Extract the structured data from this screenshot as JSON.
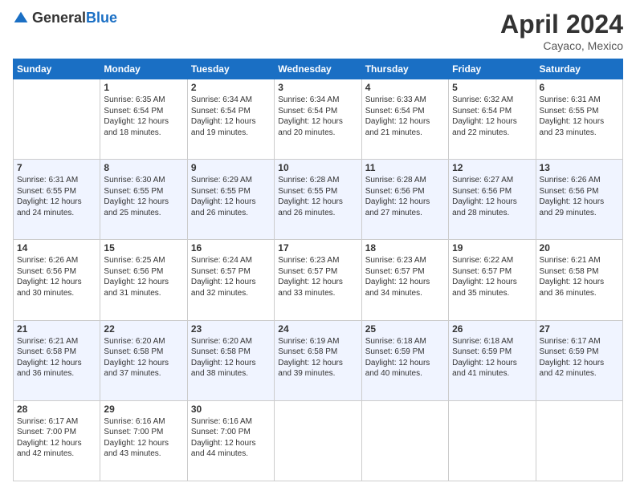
{
  "header": {
    "logo_general": "General",
    "logo_blue": "Blue",
    "title": "April 2024",
    "location": "Cayaco, Mexico"
  },
  "columns": [
    "Sunday",
    "Monday",
    "Tuesday",
    "Wednesday",
    "Thursday",
    "Friday",
    "Saturday"
  ],
  "weeks": [
    [
      {
        "day": "",
        "sunrise": "",
        "sunset": "",
        "daylight": ""
      },
      {
        "day": "1",
        "sunrise": "Sunrise: 6:35 AM",
        "sunset": "Sunset: 6:54 PM",
        "daylight": "Daylight: 12 hours and 18 minutes."
      },
      {
        "day": "2",
        "sunrise": "Sunrise: 6:34 AM",
        "sunset": "Sunset: 6:54 PM",
        "daylight": "Daylight: 12 hours and 19 minutes."
      },
      {
        "day": "3",
        "sunrise": "Sunrise: 6:34 AM",
        "sunset": "Sunset: 6:54 PM",
        "daylight": "Daylight: 12 hours and 20 minutes."
      },
      {
        "day": "4",
        "sunrise": "Sunrise: 6:33 AM",
        "sunset": "Sunset: 6:54 PM",
        "daylight": "Daylight: 12 hours and 21 minutes."
      },
      {
        "day": "5",
        "sunrise": "Sunrise: 6:32 AM",
        "sunset": "Sunset: 6:54 PM",
        "daylight": "Daylight: 12 hours and 22 minutes."
      },
      {
        "day": "6",
        "sunrise": "Sunrise: 6:31 AM",
        "sunset": "Sunset: 6:55 PM",
        "daylight": "Daylight: 12 hours and 23 minutes."
      }
    ],
    [
      {
        "day": "7",
        "sunrise": "Sunrise: 6:31 AM",
        "sunset": "Sunset: 6:55 PM",
        "daylight": "Daylight: 12 hours and 24 minutes."
      },
      {
        "day": "8",
        "sunrise": "Sunrise: 6:30 AM",
        "sunset": "Sunset: 6:55 PM",
        "daylight": "Daylight: 12 hours and 25 minutes."
      },
      {
        "day": "9",
        "sunrise": "Sunrise: 6:29 AM",
        "sunset": "Sunset: 6:55 PM",
        "daylight": "Daylight: 12 hours and 26 minutes."
      },
      {
        "day": "10",
        "sunrise": "Sunrise: 6:28 AM",
        "sunset": "Sunset: 6:55 PM",
        "daylight": "Daylight: 12 hours and 26 minutes."
      },
      {
        "day": "11",
        "sunrise": "Sunrise: 6:28 AM",
        "sunset": "Sunset: 6:56 PM",
        "daylight": "Daylight: 12 hours and 27 minutes."
      },
      {
        "day": "12",
        "sunrise": "Sunrise: 6:27 AM",
        "sunset": "Sunset: 6:56 PM",
        "daylight": "Daylight: 12 hours and 28 minutes."
      },
      {
        "day": "13",
        "sunrise": "Sunrise: 6:26 AM",
        "sunset": "Sunset: 6:56 PM",
        "daylight": "Daylight: 12 hours and 29 minutes."
      }
    ],
    [
      {
        "day": "14",
        "sunrise": "Sunrise: 6:26 AM",
        "sunset": "Sunset: 6:56 PM",
        "daylight": "Daylight: 12 hours and 30 minutes."
      },
      {
        "day": "15",
        "sunrise": "Sunrise: 6:25 AM",
        "sunset": "Sunset: 6:56 PM",
        "daylight": "Daylight: 12 hours and 31 minutes."
      },
      {
        "day": "16",
        "sunrise": "Sunrise: 6:24 AM",
        "sunset": "Sunset: 6:57 PM",
        "daylight": "Daylight: 12 hours and 32 minutes."
      },
      {
        "day": "17",
        "sunrise": "Sunrise: 6:23 AM",
        "sunset": "Sunset: 6:57 PM",
        "daylight": "Daylight: 12 hours and 33 minutes."
      },
      {
        "day": "18",
        "sunrise": "Sunrise: 6:23 AM",
        "sunset": "Sunset: 6:57 PM",
        "daylight": "Daylight: 12 hours and 34 minutes."
      },
      {
        "day": "19",
        "sunrise": "Sunrise: 6:22 AM",
        "sunset": "Sunset: 6:57 PM",
        "daylight": "Daylight: 12 hours and 35 minutes."
      },
      {
        "day": "20",
        "sunrise": "Sunrise: 6:21 AM",
        "sunset": "Sunset: 6:58 PM",
        "daylight": "Daylight: 12 hours and 36 minutes."
      }
    ],
    [
      {
        "day": "21",
        "sunrise": "Sunrise: 6:21 AM",
        "sunset": "Sunset: 6:58 PM",
        "daylight": "Daylight: 12 hours and 36 minutes."
      },
      {
        "day": "22",
        "sunrise": "Sunrise: 6:20 AM",
        "sunset": "Sunset: 6:58 PM",
        "daylight": "Daylight: 12 hours and 37 minutes."
      },
      {
        "day": "23",
        "sunrise": "Sunrise: 6:20 AM",
        "sunset": "Sunset: 6:58 PM",
        "daylight": "Daylight: 12 hours and 38 minutes."
      },
      {
        "day": "24",
        "sunrise": "Sunrise: 6:19 AM",
        "sunset": "Sunset: 6:58 PM",
        "daylight": "Daylight: 12 hours and 39 minutes."
      },
      {
        "day": "25",
        "sunrise": "Sunrise: 6:18 AM",
        "sunset": "Sunset: 6:59 PM",
        "daylight": "Daylight: 12 hours and 40 minutes."
      },
      {
        "day": "26",
        "sunrise": "Sunrise: 6:18 AM",
        "sunset": "Sunset: 6:59 PM",
        "daylight": "Daylight: 12 hours and 41 minutes."
      },
      {
        "day": "27",
        "sunrise": "Sunrise: 6:17 AM",
        "sunset": "Sunset: 6:59 PM",
        "daylight": "Daylight: 12 hours and 42 minutes."
      }
    ],
    [
      {
        "day": "28",
        "sunrise": "Sunrise: 6:17 AM",
        "sunset": "Sunset: 7:00 PM",
        "daylight": "Daylight: 12 hours and 42 minutes."
      },
      {
        "day": "29",
        "sunrise": "Sunrise: 6:16 AM",
        "sunset": "Sunset: 7:00 PM",
        "daylight": "Daylight: 12 hours and 43 minutes."
      },
      {
        "day": "30",
        "sunrise": "Sunrise: 6:16 AM",
        "sunset": "Sunset: 7:00 PM",
        "daylight": "Daylight: 12 hours and 44 minutes."
      },
      {
        "day": "",
        "sunrise": "",
        "sunset": "",
        "daylight": ""
      },
      {
        "day": "",
        "sunrise": "",
        "sunset": "",
        "daylight": ""
      },
      {
        "day": "",
        "sunrise": "",
        "sunset": "",
        "daylight": ""
      },
      {
        "day": "",
        "sunrise": "",
        "sunset": "",
        "daylight": ""
      }
    ]
  ]
}
